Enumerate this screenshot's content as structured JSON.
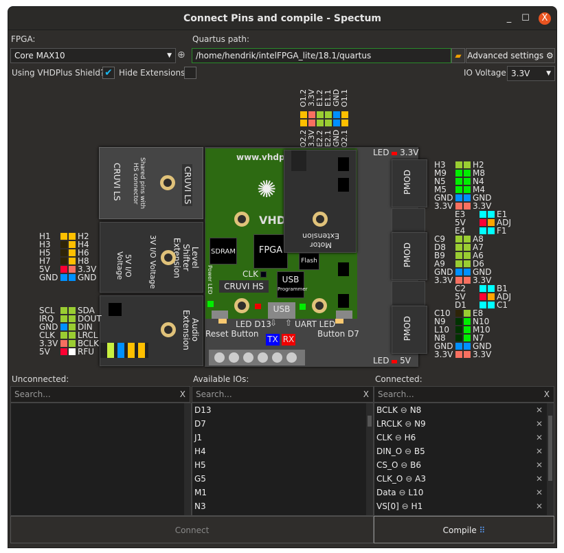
{
  "window": {
    "title": "Connect Pins and compile - Spectum",
    "minimize": "_",
    "maximize": "☐",
    "close": "X"
  },
  "top": {
    "fpga_label": "FPGA:",
    "fpga_value": "Core MAX10",
    "add_icon": "⊕",
    "quartus_label": "Quartus path:",
    "quartus_value": "/home/hendrik/intelFPGA_lite/18.1/quartus",
    "folder_icon": "folder-icon",
    "advanced": "Advanced settings",
    "gear": "⚙",
    "shield_label": "Using VHDPlus Shield?",
    "shield_checked": true,
    "hide_label": "Hide Extensions",
    "hide_checked": false,
    "io_label": "IO Voltage",
    "io_value": "3.3V"
  },
  "colors": {
    "yellow": "#ffc000",
    "salmon": "#f87060",
    "green": "#9acd32",
    "blue": "#0090ff",
    "red": "#ff0033",
    "white": "#ffffff",
    "bright": "#00ee00",
    "cyan": "#00ffff",
    "orange": "#ffa500",
    "dark": "#2e2408",
    "darkgreen": "#003300"
  },
  "board": {
    "top_header": {
      "top": [
        "O1.2",
        "3.3V",
        "E1.2",
        "E1.1",
        "GND",
        "O1.1"
      ],
      "bottom": [
        "O2.2",
        "3.3V",
        "E2.2",
        "E2.1",
        "GND",
        "O2.1"
      ],
      "colors": [
        "yellow",
        "salmon",
        "green",
        "green",
        "blue",
        "yellow"
      ]
    },
    "site": "www.vhdp",
    "logo": "VHDP",
    "sdram": "SDRAM",
    "fpga": "FPGA",
    "flash": "Flash",
    "clk": "CLK",
    "usb": "USB",
    "programmer": "Programmer",
    "cruvi_hs": "CRUVI HS",
    "power_led": "Power LED",
    "usb_port": "USB",
    "led_d13": "LED D13",
    "uart_led": "UART LED",
    "reset": "Reset Button",
    "button_d7": "Button D7",
    "tx": "TX",
    "rx": "RX",
    "led33": "LED",
    "v33": "3.3V",
    "led5": "LED",
    "v5": "5V",
    "pmod": "PMOD",
    "cruvi_ls": {
      "title": "CRUVI LS",
      "note": "Shared pins with HS connector",
      "tag": "CRUVI LS"
    },
    "level": {
      "title": "Level Shifter Extension",
      "note": "3V I/O Voltage",
      "note2": "5V I/O Voltage"
    },
    "audio": {
      "title": "Audio Extension"
    },
    "motor": {
      "title": "Motor Extension"
    }
  },
  "headers": {
    "cruvi": [
      [
        "H1",
        "yellow",
        "yellow",
        "H2"
      ],
      [
        "H3",
        "dark",
        "yellow",
        "H4"
      ],
      [
        "H5",
        "dark",
        "yellow",
        "H6"
      ],
      [
        "H7",
        "dark",
        "yellow",
        "H8"
      ],
      [
        "5V",
        "red",
        "salmon",
        "3.3V"
      ],
      [
        "GND",
        "blue",
        "blue",
        "GND"
      ]
    ],
    "audio": [
      [
        "SCL",
        "green",
        "green",
        "SDA"
      ],
      [
        "IRQ",
        "green",
        "green",
        "DOUT"
      ],
      [
        "GND",
        "blue",
        "green",
        "DIN"
      ],
      [
        "CLK",
        "green",
        "green",
        "LRCL"
      ],
      [
        "3.3V",
        "salmon",
        "green",
        "BCLK"
      ],
      [
        "5V",
        "red",
        "white",
        "RFU"
      ]
    ],
    "pmod1": [
      [
        "H3",
        "green",
        "green",
        "H2"
      ],
      [
        "M9",
        "bright",
        "bright",
        "M8"
      ],
      [
        "N5",
        "bright",
        "bright",
        "N4"
      ],
      [
        "M5",
        "bright",
        "bright",
        "M4"
      ],
      [
        "GND",
        "blue",
        "blue",
        "GND"
      ],
      [
        "3.3V",
        "salmon",
        "salmon",
        "3.3V"
      ]
    ],
    "mid1": [
      [
        "E3",
        "cyan",
        "cyan",
        "E1"
      ],
      [
        "5V",
        "red",
        "orange",
        "ADJ"
      ],
      [
        "E4",
        "cyan",
        "cyan",
        "F1"
      ]
    ],
    "pmod2": [
      [
        "C9",
        "green",
        "green",
        "A8"
      ],
      [
        "D8",
        "green",
        "green",
        "A7"
      ],
      [
        "B9",
        "green",
        "green",
        "A6"
      ],
      [
        "A9",
        "green",
        "green",
        "D6"
      ],
      [
        "GND",
        "blue",
        "blue",
        "GND"
      ],
      [
        "3.3V",
        "salmon",
        "salmon",
        "3.3V"
      ]
    ],
    "mid2": [
      [
        "C2",
        "cyan",
        "cyan",
        "B1"
      ],
      [
        "5V",
        "red",
        "orange",
        "ADJ"
      ],
      [
        "D1",
        "cyan",
        "cyan",
        "C1"
      ]
    ],
    "pmod3": [
      [
        "C10",
        "dark",
        "green",
        "E8"
      ],
      [
        "N9",
        "darkgreen",
        "bright",
        "N10"
      ],
      [
        "L10",
        "darkgreen",
        "bright",
        "M10"
      ],
      [
        "N8",
        "darkgreen",
        "bright",
        "N7"
      ],
      [
        "GND",
        "blue",
        "blue",
        "GND"
      ],
      [
        "3.3V",
        "salmon",
        "salmon",
        "3.3V"
      ]
    ]
  },
  "bottom": {
    "unconnected_label": "Unconnected:",
    "available_label": "Available IOs:",
    "connected_label": "Connected:",
    "search_placeholder": "Search...",
    "clear": "X",
    "available": [
      "D13",
      "D7",
      "J1",
      "H4",
      "H5",
      "G5",
      "M1",
      "N3"
    ],
    "connected": [
      [
        "BCLK",
        "N8"
      ],
      [
        "LRCLK",
        "N9"
      ],
      [
        "CLK",
        "H6"
      ],
      [
        "DIN_O",
        "B5"
      ],
      [
        "CS_O",
        "B6"
      ],
      [
        "CLK_O",
        "A3"
      ],
      [
        "Data",
        "L10"
      ],
      [
        "VS[0]",
        "H1"
      ]
    ],
    "link_icon": "⊖",
    "remove_icon": "✕",
    "connect": "Connect",
    "compile": "Compile",
    "compile_icon": "⠿"
  }
}
